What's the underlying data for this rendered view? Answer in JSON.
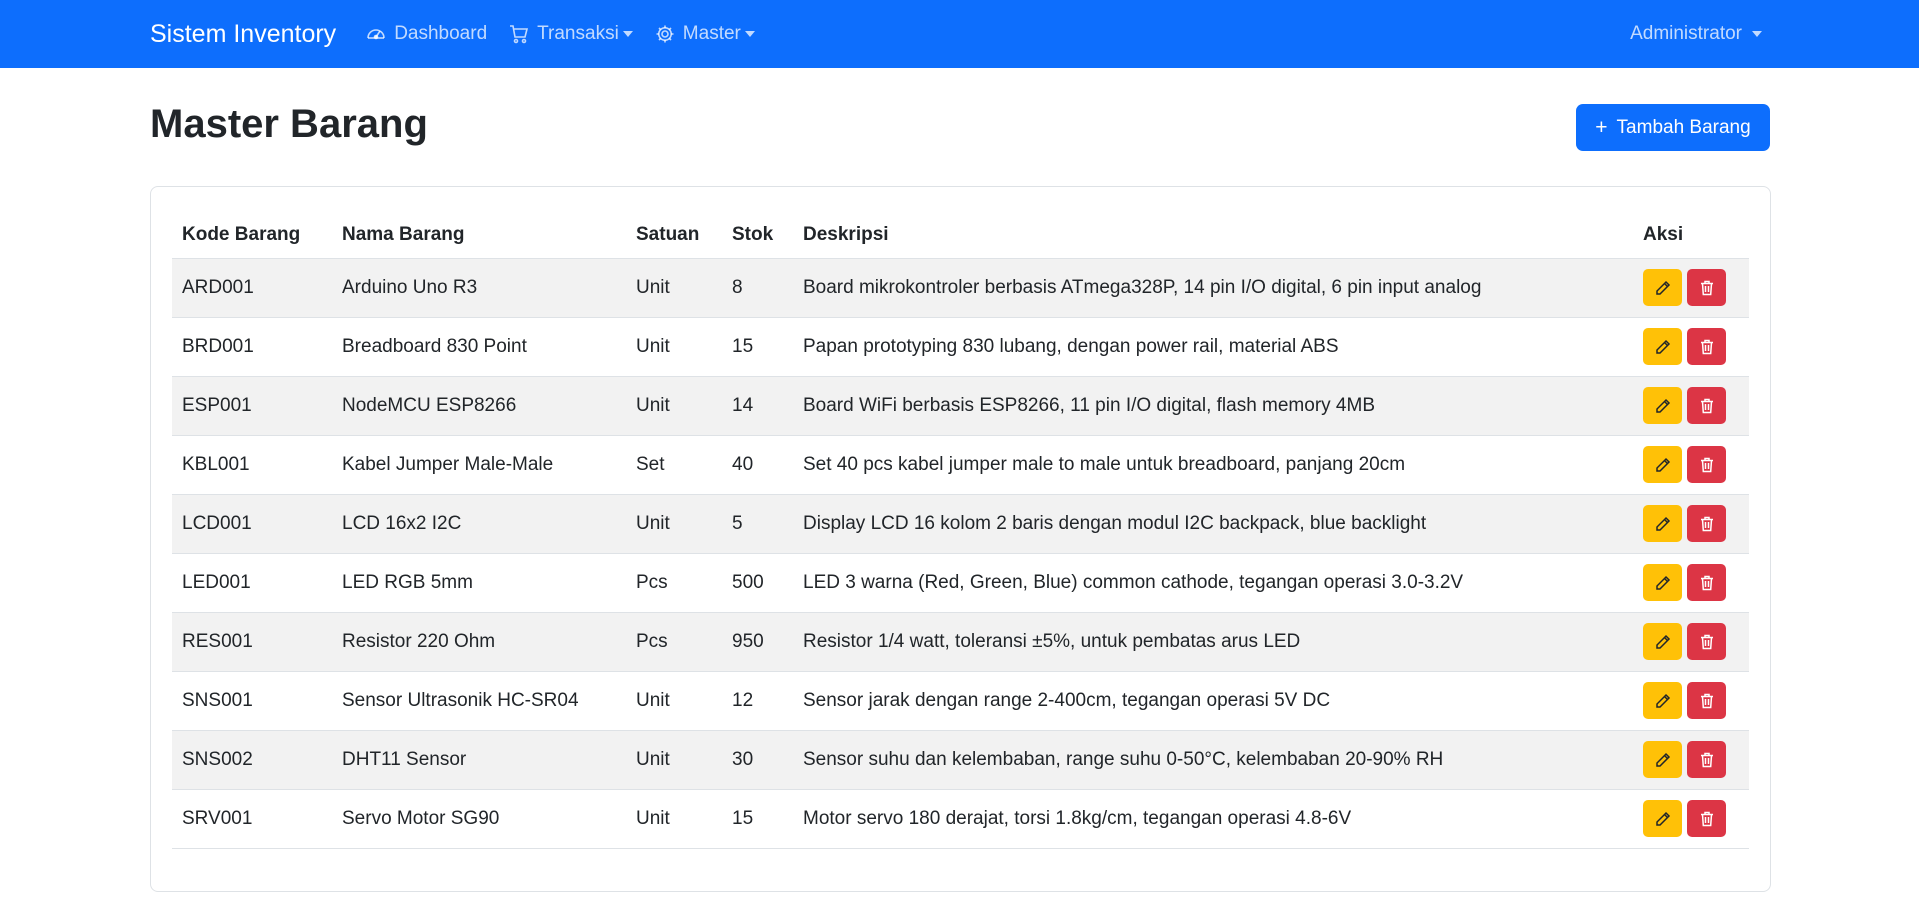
{
  "navbar": {
    "brand": "Sistem Inventory",
    "items": [
      {
        "label": "Dashboard",
        "icon": "speedometer-icon"
      },
      {
        "label": "Transaksi",
        "icon": "cart-icon"
      },
      {
        "label": "Master",
        "icon": "gear-icon"
      }
    ],
    "user": "Administrator"
  },
  "page": {
    "title": "Master Barang",
    "add_button": "Tambah Barang"
  },
  "table": {
    "headers": [
      "Kode Barang",
      "Nama Barang",
      "Satuan",
      "Stok",
      "Deskripsi",
      "Aksi"
    ],
    "rows": [
      {
        "kode": "ARD001",
        "nama": "Arduino Uno R3",
        "satuan": "Unit",
        "stok": "8",
        "deskripsi": "Board mikrokontroler berbasis ATmega328P, 14 pin I/O digital, 6 pin input analog"
      },
      {
        "kode": "BRD001",
        "nama": "Breadboard 830 Point",
        "satuan": "Unit",
        "stok": "15",
        "deskripsi": "Papan prototyping 830 lubang, dengan power rail, material ABS"
      },
      {
        "kode": "ESP001",
        "nama": "NodeMCU ESP8266",
        "satuan": "Unit",
        "stok": "14",
        "deskripsi": "Board WiFi berbasis ESP8266, 11 pin I/O digital, flash memory 4MB"
      },
      {
        "kode": "KBL001",
        "nama": "Kabel Jumper Male-Male",
        "satuan": "Set",
        "stok": "40",
        "deskripsi": "Set 40 pcs kabel jumper male to male untuk breadboard, panjang 20cm"
      },
      {
        "kode": "LCD001",
        "nama": "LCD 16x2 I2C",
        "satuan": "Unit",
        "stok": "5",
        "deskripsi": "Display LCD 16 kolom 2 baris dengan modul I2C backpack, blue backlight"
      },
      {
        "kode": "LED001",
        "nama": "LED RGB 5mm",
        "satuan": "Pcs",
        "stok": "500",
        "deskripsi": "LED 3 warna (Red, Green, Blue) common cathode, tegangan operasi 3.0-3.2V"
      },
      {
        "kode": "RES001",
        "nama": "Resistor 220 Ohm",
        "satuan": "Pcs",
        "stok": "950",
        "deskripsi": "Resistor 1/4 watt, toleransi ±5%, untuk pembatas arus LED"
      },
      {
        "kode": "SNS001",
        "nama": "Sensor Ultrasonik HC-SR04",
        "satuan": "Unit",
        "stok": "12",
        "deskripsi": "Sensor jarak dengan range 2-400cm, tegangan operasi 5V DC"
      },
      {
        "kode": "SNS002",
        "nama": "DHT11 Sensor",
        "satuan": "Unit",
        "stok": "30",
        "deskripsi": "Sensor suhu dan kelembaban, range suhu 0-50°C, kelembaban 20-90% RH"
      },
      {
        "kode": "SRV001",
        "nama": "Servo Motor SG90",
        "satuan": "Unit",
        "stok": "15",
        "deskripsi": "Motor servo 180 derajat, torsi 1.8kg/cm, tegangan operasi 4.8-6V"
      }
    ]
  },
  "colors": {
    "primary": "#0d6efd",
    "warning": "#ffc107",
    "danger": "#dc3545"
  }
}
